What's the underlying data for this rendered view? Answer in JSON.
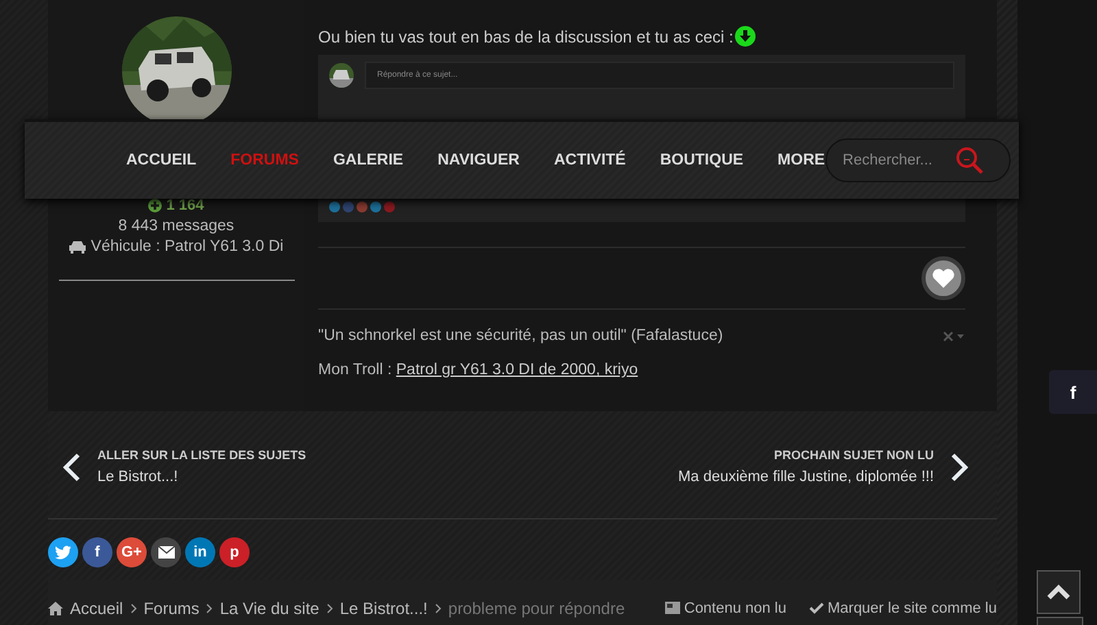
{
  "author": {
    "reputation": "1 164",
    "posts": "8 443 messages",
    "vehicle": "Véhicule : Patrol Y61 3.0 Di"
  },
  "post": {
    "text": "Ou bien tu vas tout en bas de la discussion et tu as ceci :",
    "embed": {
      "placeholder": "Répondre à ce sujet..."
    }
  },
  "signature": {
    "quote": "\"Un schnorkel est une sécurité, pas un outil\" (Fafalastuce)",
    "prefix": "Mon Troll : ",
    "link": "Patrol gr Y61 3.0 DI de 2000, kriyo"
  },
  "nav": {
    "items": [
      {
        "label": "ACCUEIL",
        "selected": false
      },
      {
        "label": "FORUMS",
        "selected": true
      },
      {
        "label": "GALERIE",
        "selected": false
      },
      {
        "label": "NAVIGUER",
        "selected": false
      },
      {
        "label": "ACTIVITÉ",
        "selected": false
      },
      {
        "label": "BOUTIQUE",
        "selected": false
      },
      {
        "label": "MORE",
        "selected": false
      }
    ],
    "search": {
      "placeholder": "Rechercher..."
    }
  },
  "pager": {
    "prev": {
      "heading": "ALLER SUR LA LISTE DES SUJETS",
      "title": "Le Bistrot...!"
    },
    "next": {
      "heading": "PROCHAIN SUJET NON LU",
      "title": "Ma deuxième fille Justine, diplomée !!!"
    }
  },
  "share": [
    {
      "kind": "twitter"
    },
    {
      "kind": "facebook",
      "glyph": "f"
    },
    {
      "kind": "googleplus",
      "glyph": "G+"
    },
    {
      "kind": "email"
    },
    {
      "kind": "linkedin",
      "glyph": "in"
    },
    {
      "kind": "pinterest",
      "glyph": "p"
    }
  ],
  "breadcrumb": {
    "items": [
      "Accueil",
      "Forums",
      "La Vie du site",
      "Le Bistrot...!"
    ],
    "current": "probleme pour répondre"
  },
  "actions": [
    {
      "kind": "unread",
      "label": "Contenu non lu"
    },
    {
      "kind": "mark",
      "label": "Marquer le site comme lu"
    }
  ],
  "floating": {
    "facebook_glyph": "f"
  }
}
